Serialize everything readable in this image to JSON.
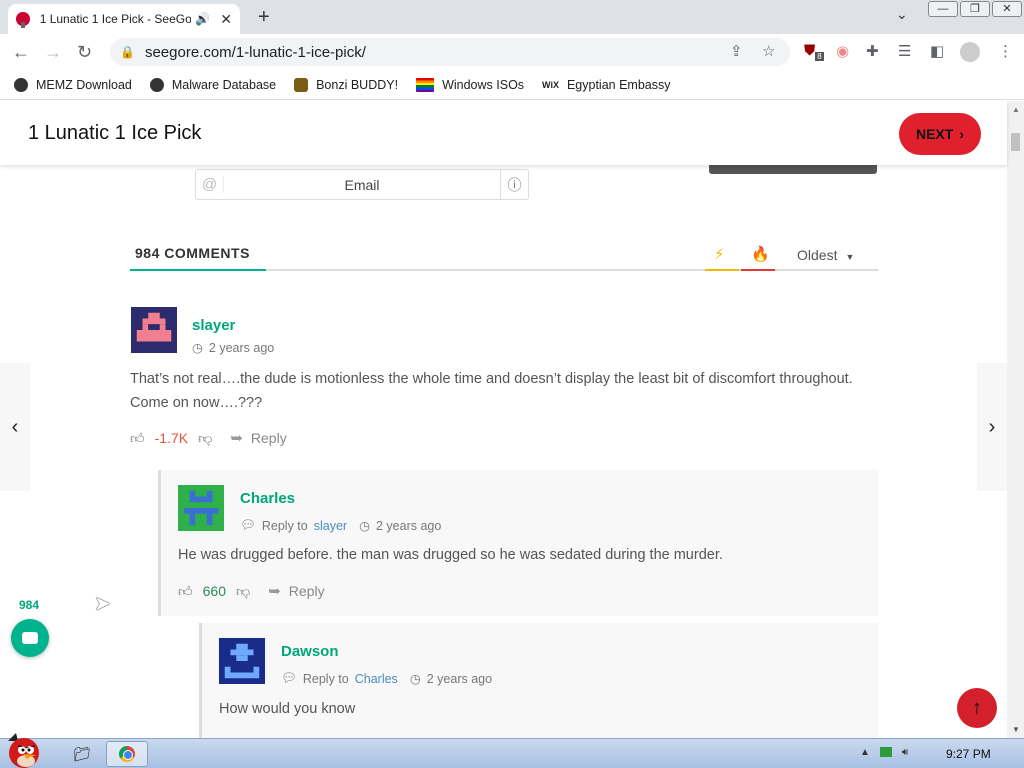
{
  "browser": {
    "tab_title": "1 Lunatic 1 Ice Pick - SeeGore",
    "url": "seegore.com/1-lunatic-1-ice-pick/",
    "bookmarks": [
      {
        "label": "MEMZ Download",
        "icon": "globe-icon"
      },
      {
        "label": "Malware Database",
        "icon": "globe-icon"
      },
      {
        "label": "Bonzi BUDDY!",
        "icon": "bonzi-icon"
      },
      {
        "label": "Windows ISOs",
        "icon": "rainbow-flag-icon"
      },
      {
        "label": "Egyptian Embassy",
        "icon": "wix-icon"
      }
    ],
    "extension_badge": "8"
  },
  "site": {
    "page_title": "1 Lunatic 1 Ice Pick",
    "next_label": "NEXT",
    "email_placeholder": "Email"
  },
  "comments_section": {
    "count_label": "984 COMMENTS",
    "sort_label": "Oldest",
    "colors": {
      "accent": "#00a77a",
      "bolt": "#f1b800",
      "fire": "#e53935"
    }
  },
  "comments": [
    {
      "author": "slayer",
      "time": "2 years ago",
      "text": "That’s not real….the dude is motionless the whole time and doesn’t display the least bit of discomfort throughout. Come on now….???",
      "votes": "-1.7K",
      "reply_label": "Reply"
    },
    {
      "author": "Charles",
      "reply_to_prefix": "Reply to",
      "reply_to": "slayer",
      "time": "2 years ago",
      "text": "He was drugged before. the man was drugged so he was sedated during the murder.",
      "votes": "660",
      "reply_label": "Reply"
    },
    {
      "author": "Dawson",
      "reply_to_prefix": "Reply to",
      "reply_to": "Charles",
      "time": "2 years ago",
      "text": "How would you know"
    }
  ],
  "floating": {
    "comment_count": "984"
  },
  "taskbar": {
    "clock": "9:27 PM"
  }
}
